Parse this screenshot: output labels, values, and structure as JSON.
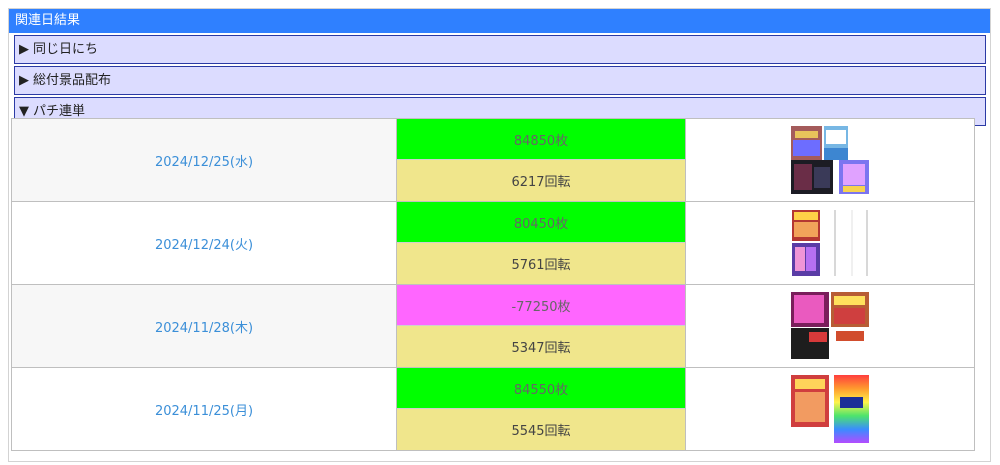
{
  "header": {
    "title": "関連日結果"
  },
  "sections": [
    {
      "arrow": "▶",
      "label": "同じ日にち"
    },
    {
      "arrow": "▶",
      "label": "総付景品配布"
    },
    {
      "arrow": "▼",
      "label": "パチ連単"
    }
  ],
  "rows": [
    {
      "date": "2024/12/25(水)",
      "coins": "84850枚",
      "spins": "6217回転",
      "coins_color": "#00ff00"
    },
    {
      "date": "2024/12/24(火)",
      "coins": "80450枚",
      "spins": "5761回転",
      "coins_color": "#00ff00"
    },
    {
      "date": "2024/11/28(木)",
      "coins": "-77250枚",
      "spins": "5347回転",
      "coins_color": "#ff66ff"
    },
    {
      "date": "2024/11/25(月)",
      "coins": "84550枚",
      "spins": "5545回転",
      "coins_color": "#00ff00"
    }
  ],
  "thumbnails": [
    {
      "name": "thumbnail-2024-12-25"
    },
    {
      "name": "thumbnail-2024-12-24"
    },
    {
      "name": "thumbnail-2024-11-28"
    },
    {
      "name": "thumbnail-2024-11-25"
    }
  ]
}
